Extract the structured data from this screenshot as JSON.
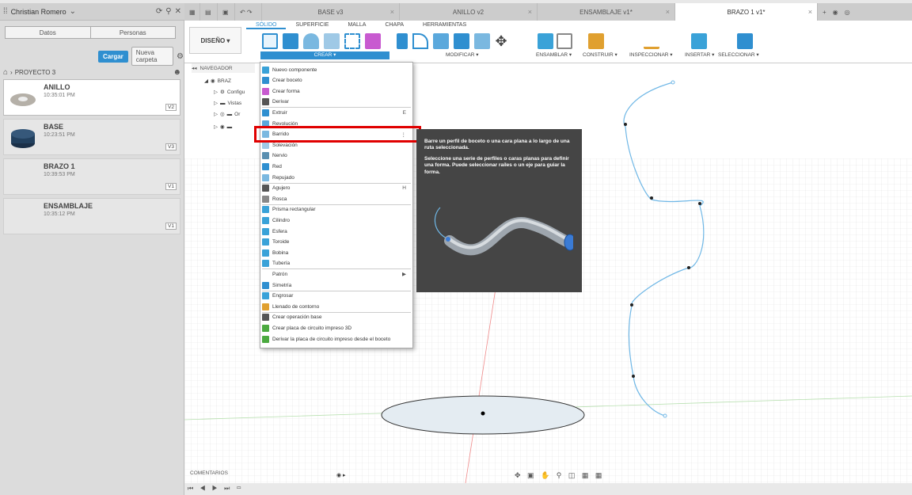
{
  "colors": {
    "accent": "#2f8fd0",
    "highlight": "#e00000",
    "sketch_line": "#6fb7e6"
  },
  "left_panel": {
    "user": "Christian Romero",
    "tabs": [
      "Datos",
      "Personas"
    ],
    "load_button": "Cargar",
    "new_folder_button": "Nueva carpeta",
    "project": "PROYECTO 3",
    "files": [
      {
        "name": "ANILLO",
        "time": "10:35:01 PM",
        "version": "V2"
      },
      {
        "name": "BASE",
        "time": "10:23:51 PM",
        "version": "V3"
      },
      {
        "name": "BRAZO 1",
        "time": "10:39:53 PM",
        "version": "V1"
      },
      {
        "name": "ENSAMBLAJE",
        "time": "10:35:12 PM",
        "version": "V1"
      }
    ]
  },
  "doc_tabs": [
    {
      "label": "BASE v3"
    },
    {
      "label": "ANILLO v2"
    },
    {
      "label": "ENSAMBLAJE v1*"
    },
    {
      "label": "BRAZO 1 v1*"
    }
  ],
  "toolbar": {
    "workspace": "DISEÑO",
    "subtabs": [
      "SÓLIDO",
      "SUPERFICIE",
      "MALLA",
      "CHAPA",
      "HERRAMIENTAS"
    ],
    "groups": [
      "CREAR",
      "MODIFICAR",
      "ENSAMBLAR",
      "CONSTRUIR",
      "INSPECCIONAR",
      "INSERTAR",
      "SELECCIONAR"
    ]
  },
  "navigator": {
    "title": "NAVEGADOR",
    "items": [
      "BRAZ",
      "Configu",
      "Vistas",
      "Or"
    ]
  },
  "menu": {
    "items": [
      {
        "label": "Nuevo componente"
      },
      {
        "label": "Crear boceto"
      },
      {
        "label": "Crear forma"
      },
      {
        "label": "Derivar"
      },
      {
        "label": "Extruir",
        "shortcut": "E"
      },
      {
        "label": "Revolución"
      },
      {
        "label": "Barrido"
      },
      {
        "label": "Solevación"
      },
      {
        "label": "Nervio"
      },
      {
        "label": "Red"
      },
      {
        "label": "Repujado"
      },
      {
        "label": "Agujero",
        "shortcut": "H"
      },
      {
        "label": "Rosca"
      },
      {
        "label": "Prisma rectangular"
      },
      {
        "label": "Cilindro"
      },
      {
        "label": "Esfera"
      },
      {
        "label": "Toroide"
      },
      {
        "label": "Bobina"
      },
      {
        "label": "Tubería"
      },
      {
        "label": "Patrón"
      },
      {
        "label": "Simetría"
      },
      {
        "label": "Engrosar"
      },
      {
        "label": "Llenado de contorno"
      },
      {
        "label": "Crear operación base"
      },
      {
        "label": "Crear placa de circuito impreso 3D"
      },
      {
        "label": "Derivar la placa de circuito impreso desde el boceto"
      }
    ]
  },
  "tooltip": {
    "line1": "Barre un perfil de boceto o una cara plana a lo largo de una ruta seleccionada.",
    "line2": "Seleccione una serie de perfiles o caras planas para definir una forma. Puede seleccionar raíles o un eje para guiar la forma."
  },
  "bottom": {
    "comments": "COMENTARIOS"
  }
}
